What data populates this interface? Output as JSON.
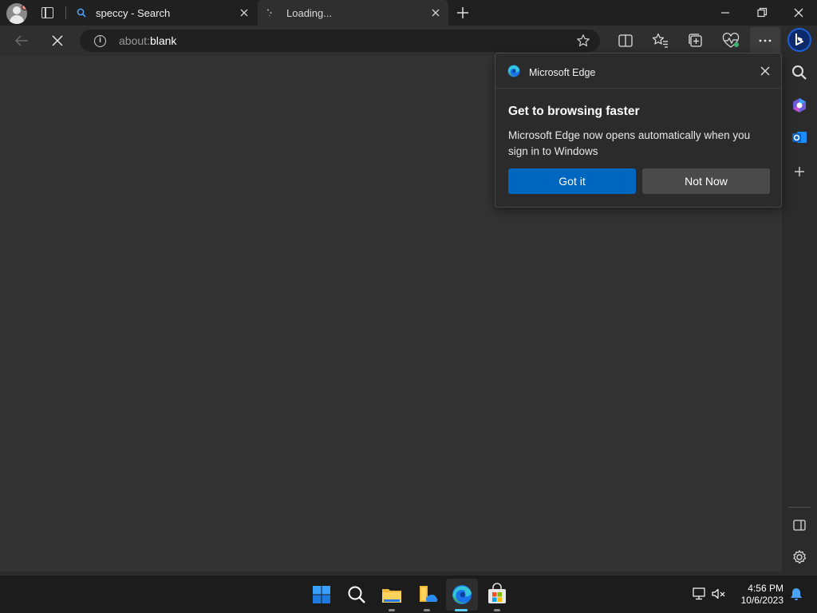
{
  "tabs": [
    {
      "label": "speccy - Search",
      "icon": "search-icon",
      "active": false
    },
    {
      "label": "Loading...",
      "icon": "loading-spinner-icon",
      "active": true
    }
  ],
  "address_bar": {
    "url_prefix": "about:",
    "url_main": "blank"
  },
  "flyout": {
    "brand": "Microsoft Edge",
    "title": "Get to browsing faster",
    "body": "Microsoft Edge now opens automatically when you sign in to Windows",
    "primary_label": "Got it",
    "secondary_label": "Not Now"
  },
  "taskbar": {
    "time": "4:56 PM",
    "date": "10/6/2023"
  },
  "colors": {
    "accent": "#0067c0",
    "page_bg": "#333333",
    "tabstrip_bg": "#202020"
  }
}
